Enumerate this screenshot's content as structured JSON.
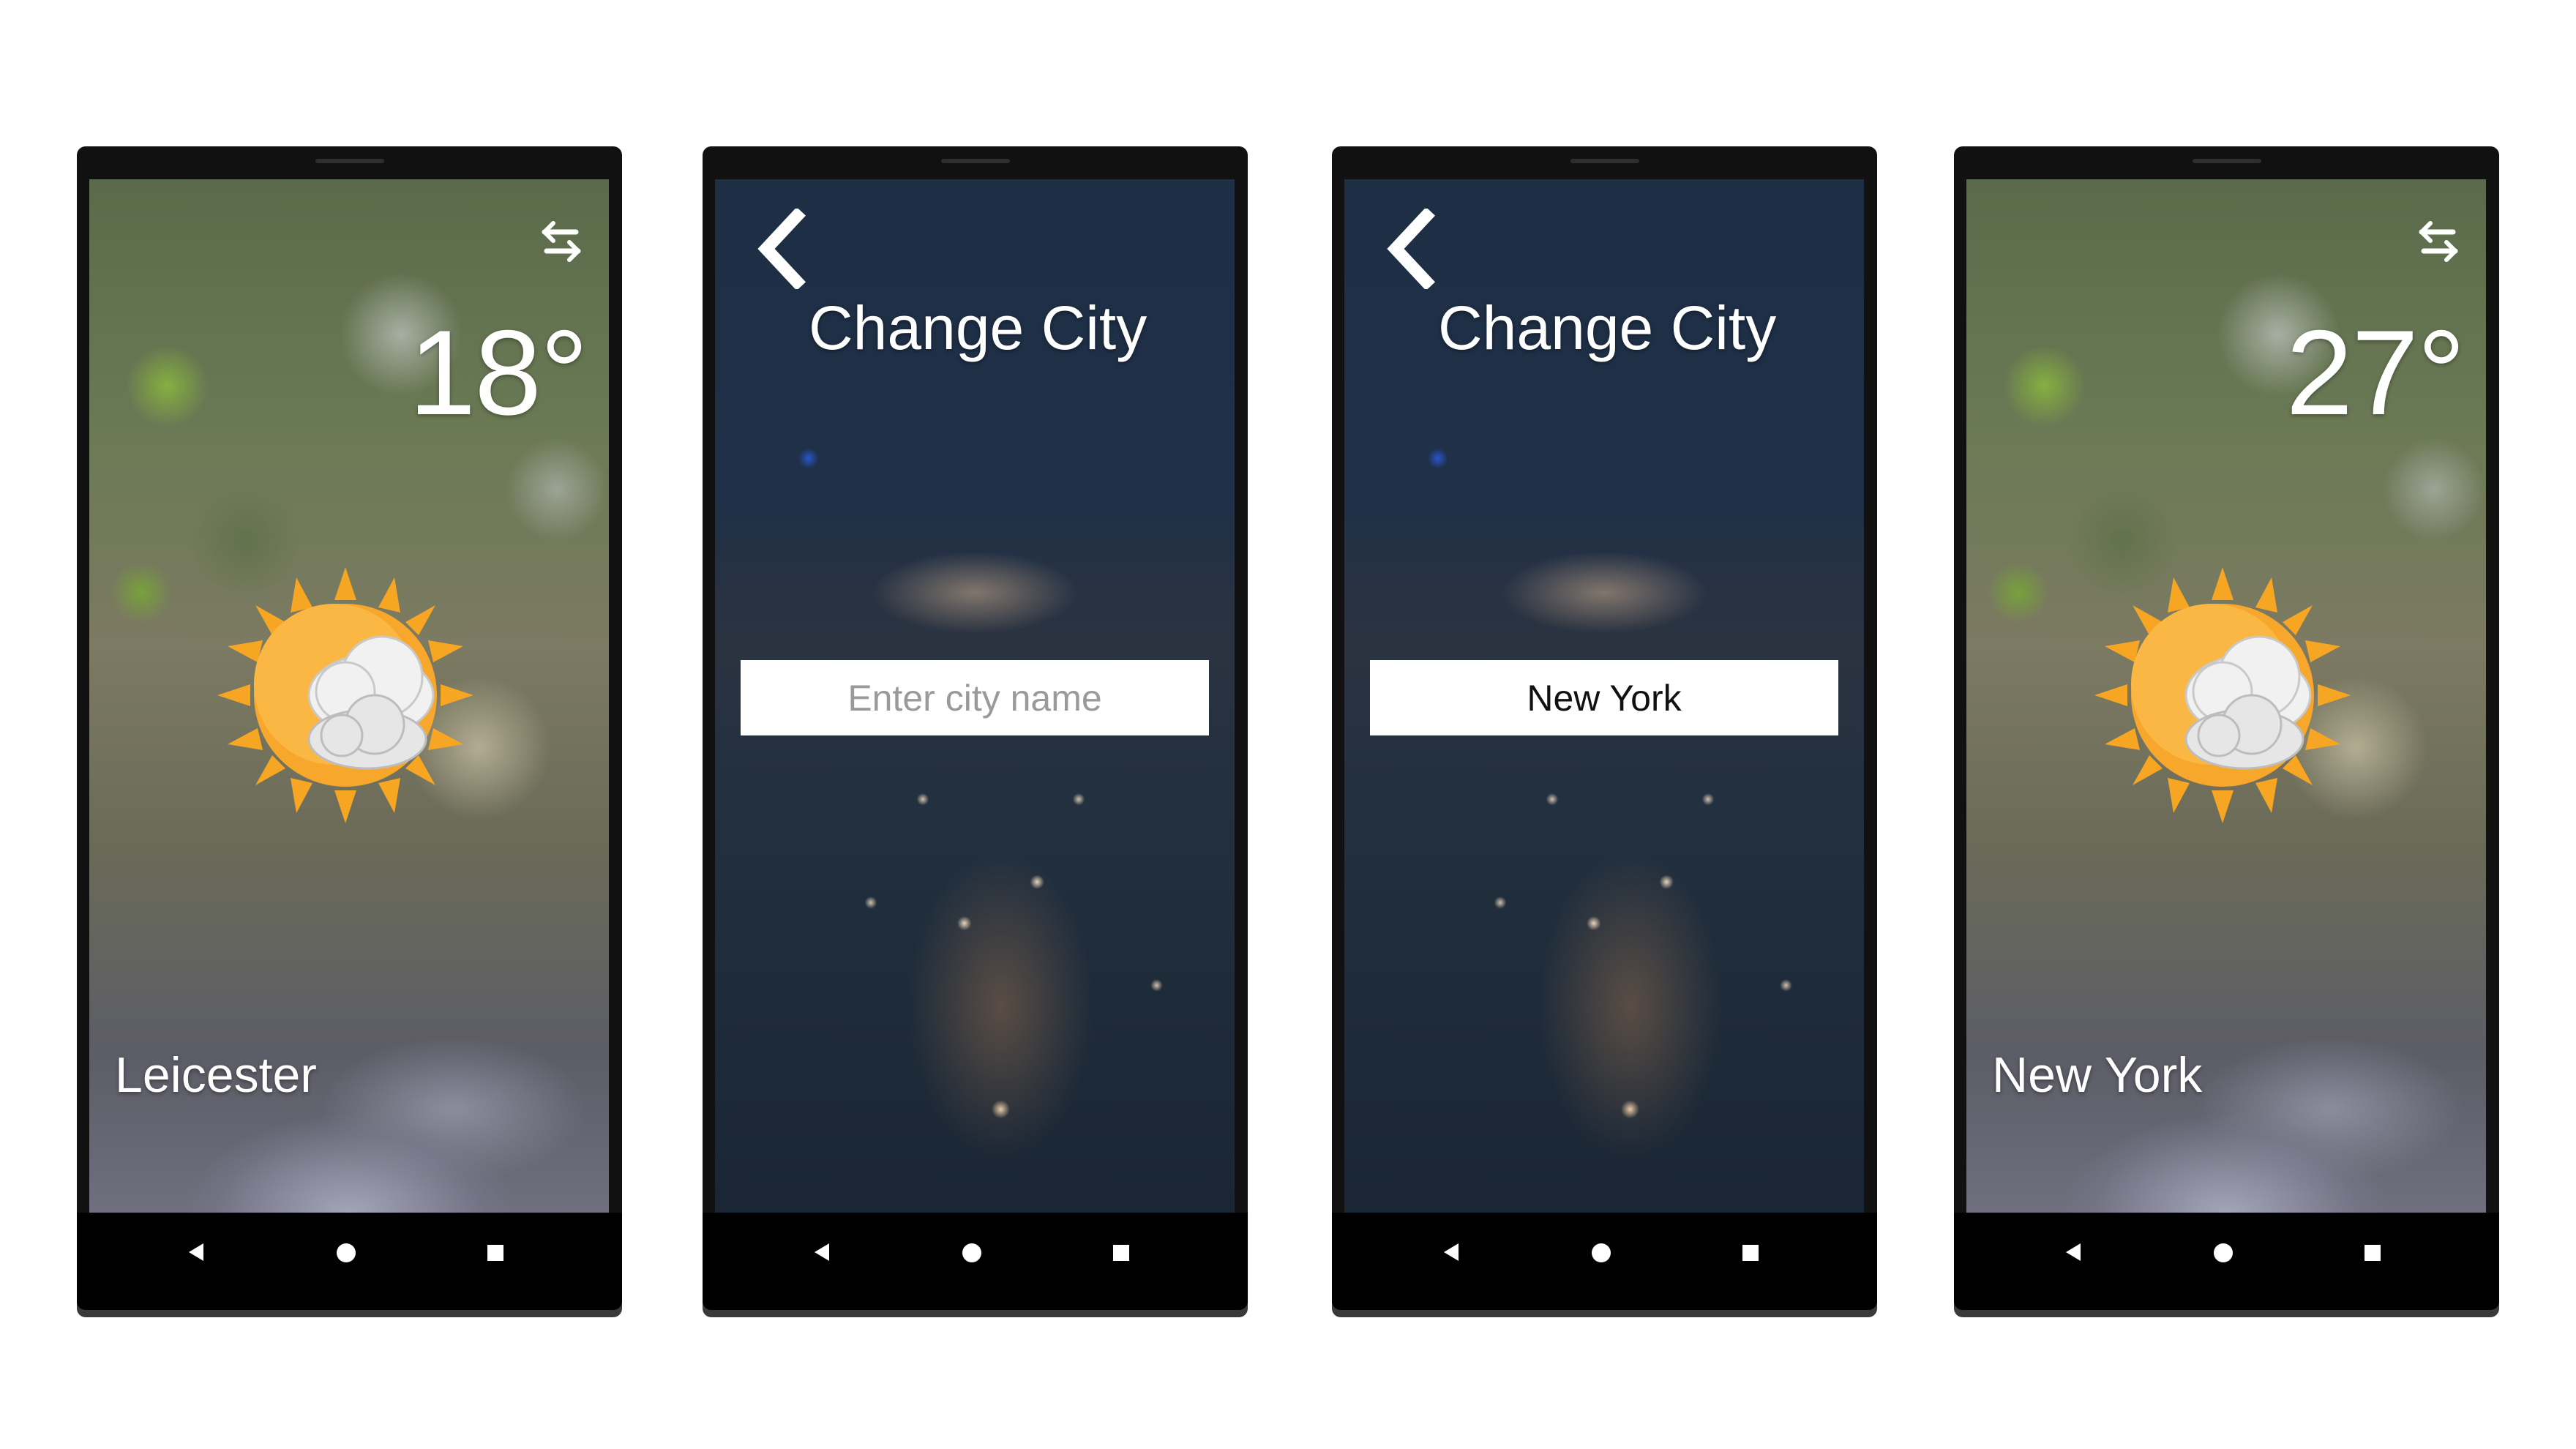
{
  "screens": [
    {
      "type": "weather",
      "temperature": "18°",
      "city": "Leicester"
    },
    {
      "type": "change-city",
      "title": "Change City",
      "input_value": "",
      "input_placeholder": "Enter city name"
    },
    {
      "type": "change-city",
      "title": "Change City",
      "input_value": "New York",
      "input_placeholder": "Enter city name"
    },
    {
      "type": "weather",
      "temperature": "27°",
      "city": "New York"
    }
  ],
  "icons": {
    "swap": "swap-arrows-icon",
    "weather": "partly-cloudy-sun-icon",
    "back": "chevron-left-icon",
    "nav_back": "nav-back-icon",
    "nav_home": "nav-home-icon",
    "nav_recent": "nav-recent-icon"
  },
  "colors": {
    "text": "#ffffff",
    "input_background": "#ffffff",
    "placeholder": "#9a9a9a",
    "caret": "#e0115f",
    "sun": "#f6a623"
  }
}
